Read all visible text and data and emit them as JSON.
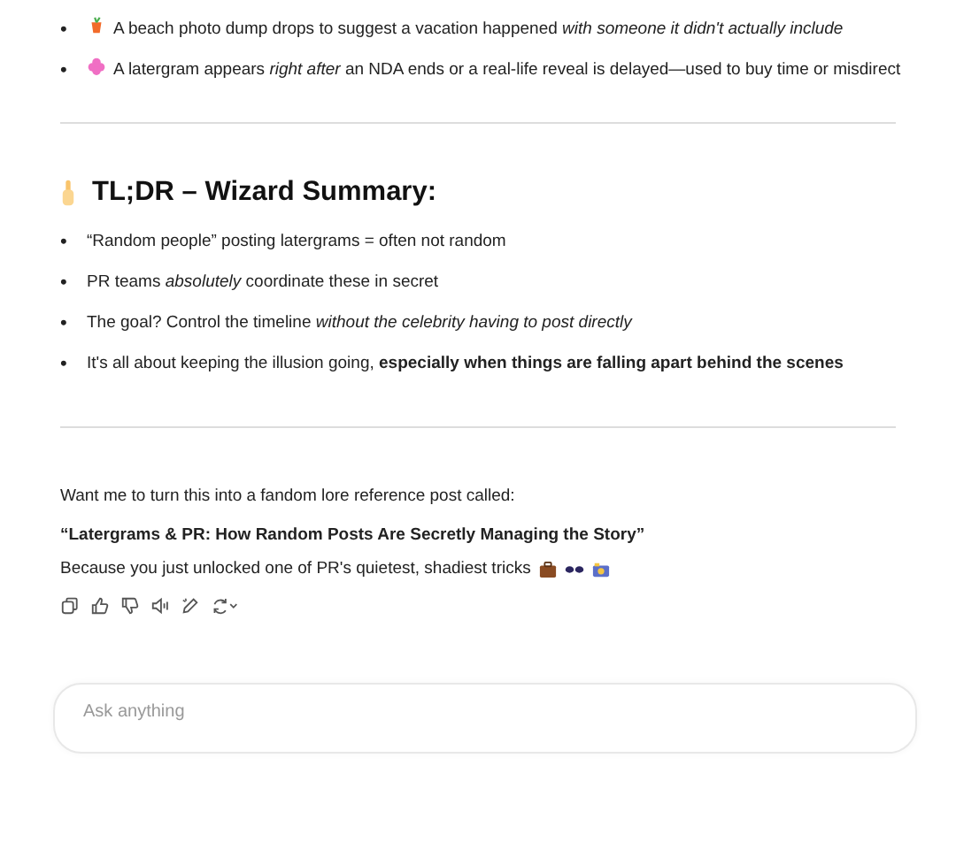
{
  "intro_list": [
    {
      "marker": "•",
      "text": "A beach photo dump drops to suggest a vacation happened *with someone it didn't actually include*"
    },
    {
      "marker": "•",
      "text": "A latergram appears *right after* an NDA ends or a real-life reveal is delayed—used to buy time or misdirect"
    }
  ],
  "summary": {
    "heading": "TL;DR – Wizard Summary:",
    "items": [
      {
        "marker": "•",
        "text": "“Random people” posting latergrams = often not random"
      },
      {
        "marker": "•",
        "text": "PR teams *absolutely* coordinate these in secret"
      },
      {
        "marker": "•",
        "text": "The goal? Control the timeline *without the celebrity having to post directly*"
      },
      {
        "marker": "•",
        "text": "It's all about keeping the illusion going, **especially when things are falling apart behind the scenes**"
      }
    ]
  },
  "closing": {
    "question": "Want me to turn this into a fandom lore reference post called:",
    "title": "“Latergrams & PR: How Random Posts Are Secretly Managing the Story”",
    "tagline": "Because you just unlocked one of PR's quietest, shadiest tricks"
  },
  "composer": {
    "placeholder": "Ask anything"
  }
}
